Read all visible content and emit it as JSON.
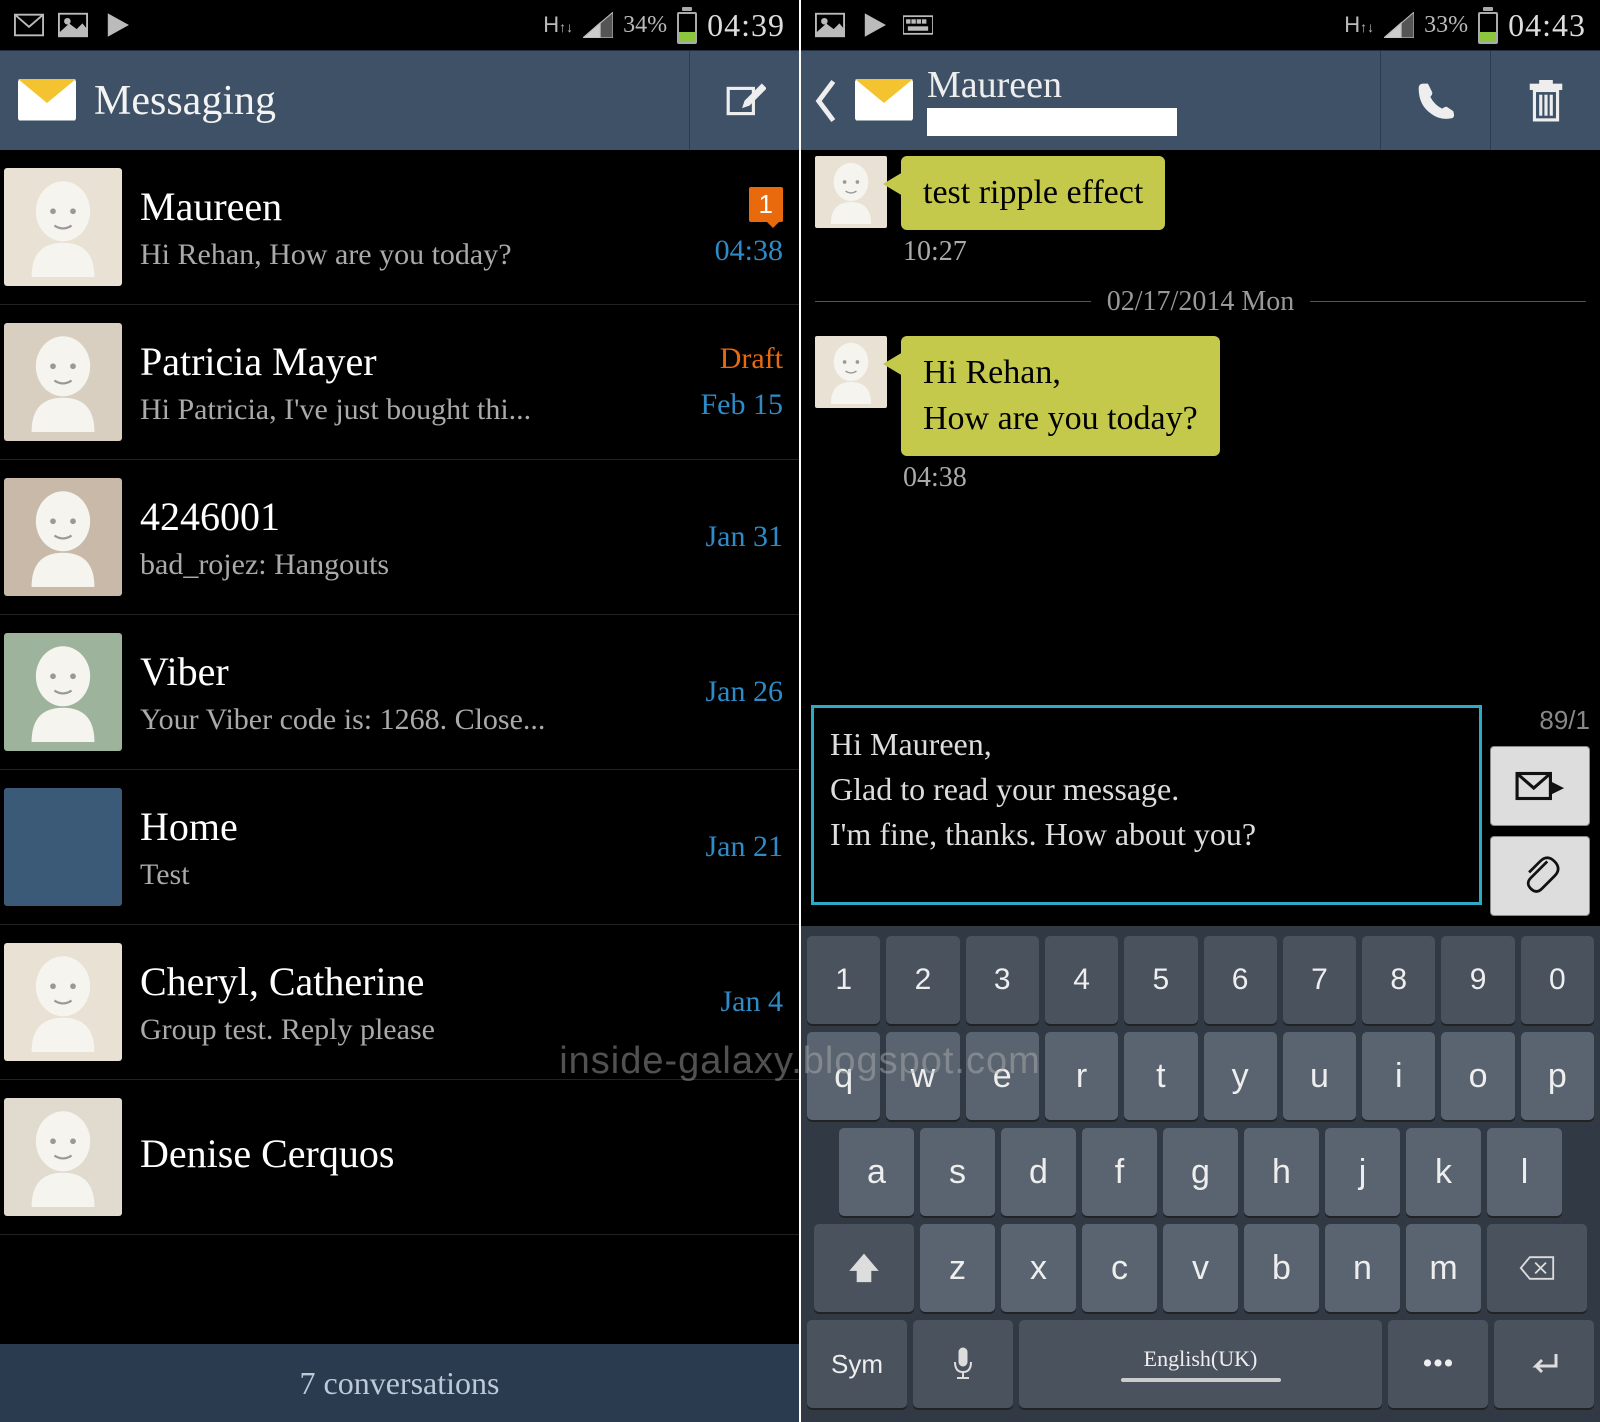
{
  "left": {
    "status": {
      "battery_pct": "34%",
      "time": "04:39",
      "battery_fill": 34
    },
    "header": {
      "title": "Messaging"
    },
    "conversations": [
      {
        "name": "Maureen",
        "preview": "Hi Rehan, How are you today?",
        "time": "04:38",
        "unread": "1",
        "avatar_bg": "#e8e1d4"
      },
      {
        "name": "Patricia Mayer",
        "preview": "Hi Patricia, I've just bought thi...",
        "time": "Feb 15",
        "draft": "Draft",
        "avatar_bg": "#d9cfc0"
      },
      {
        "name": "4246001",
        "preview": "bad_rojez: Hangouts",
        "time": "Jan 31",
        "avatar_bg": "#c8b9a8"
      },
      {
        "name": "Viber",
        "preview": "Your Viber code is: 1268. Close...",
        "time": "Jan 26",
        "avatar_bg": "#9db39b"
      },
      {
        "name": "Home",
        "preview": "Test",
        "time": "Jan 21",
        "avatar_bg": "#3a5a78",
        "photo": true
      },
      {
        "name": "Cheryl, Catherine",
        "preview": "Group test. Reply please",
        "time": "Jan 4",
        "avatar_bg": "#e8e1d4"
      },
      {
        "name": "Denise Cerquos",
        "preview": "",
        "time": "",
        "avatar_bg": "#e0dbce"
      }
    ],
    "footer": "7 conversations"
  },
  "right": {
    "status": {
      "battery_pct": "33%",
      "time": "04:43",
      "battery_fill": 33
    },
    "header": {
      "name": "Maureen"
    },
    "messages": [
      {
        "text": "test ripple effect",
        "time": "10:27"
      }
    ],
    "date_divider": "02/17/2014 Mon",
    "messages2": [
      {
        "text": "Hi Rehan,\nHow are you today?",
        "time": "04:38"
      }
    ],
    "compose": {
      "value": "Hi Maureen,\nGlad to read your message.\nI'm fine, thanks. How about you?",
      "counter": "89/1"
    },
    "keyboard": {
      "row_num": [
        "1",
        "2",
        "3",
        "4",
        "5",
        "6",
        "7",
        "8",
        "9",
        "0"
      ],
      "row1": [
        "q",
        "w",
        "e",
        "r",
        "t",
        "y",
        "u",
        "i",
        "o",
        "p"
      ],
      "row2": [
        "a",
        "s",
        "d",
        "f",
        "g",
        "h",
        "j",
        "k",
        "l"
      ],
      "row3": [
        "z",
        "x",
        "c",
        "v",
        "b",
        "n",
        "m"
      ],
      "sym": "Sym",
      "space": "English(UK)"
    }
  },
  "watermark": "inside-galaxy.blogspot.com"
}
